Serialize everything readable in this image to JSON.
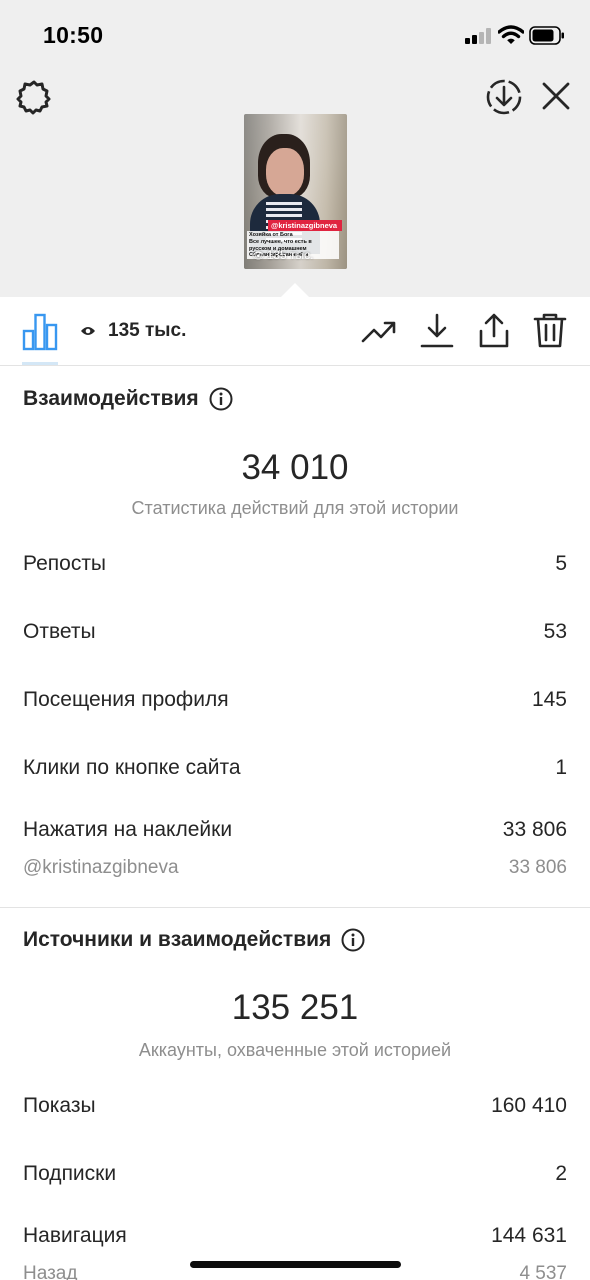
{
  "status_bar": {
    "time": "10:50"
  },
  "story_preview": {
    "tag": "@kristinazgibneva",
    "caption": "Хозяйка от Бога\nВсе лучшее, что есть в\nрусском и домашнем\nСбалансированный и",
    "views_label": "135 тыс."
  },
  "toolbar": {
    "views": "135 тыс."
  },
  "interactions": {
    "title": "Взаимодействия",
    "total": "34 010",
    "caption": "Статистика действий для этой истории",
    "rows": [
      {
        "label": "Репосты",
        "value": "5"
      },
      {
        "label": "Ответы",
        "value": "53"
      },
      {
        "label": "Посещения профиля",
        "value": "145"
      },
      {
        "label": "Клики по кнопке сайта",
        "value": "1"
      },
      {
        "label": "Нажатия на наклейки",
        "value": "33 806"
      }
    ],
    "sticker_sub": {
      "label": "@kristinazgibneva",
      "value": "33 806"
    }
  },
  "discovery": {
    "title": "Источники и взаимодействия",
    "total": "135 251",
    "caption": "Аккаунты, охваченные этой историей",
    "rows": [
      {
        "label": "Показы",
        "value": "160 410"
      },
      {
        "label": "Подписки",
        "value": "2"
      },
      {
        "label": "Навигация",
        "value": "144 631"
      }
    ],
    "navigation_sub": {
      "label": "Назад",
      "value": "4 537"
    }
  },
  "colors": {
    "accent": "#3897f0",
    "text": "#262626",
    "muted": "#8e8e8e",
    "sticker_tag": "#e02440"
  },
  "icons": [
    "gear-icon",
    "download-circle-icon",
    "close-icon",
    "bar-chart-icon",
    "eye-icon",
    "trending-icon",
    "download-icon",
    "share-icon",
    "trash-icon",
    "info-icon"
  ]
}
